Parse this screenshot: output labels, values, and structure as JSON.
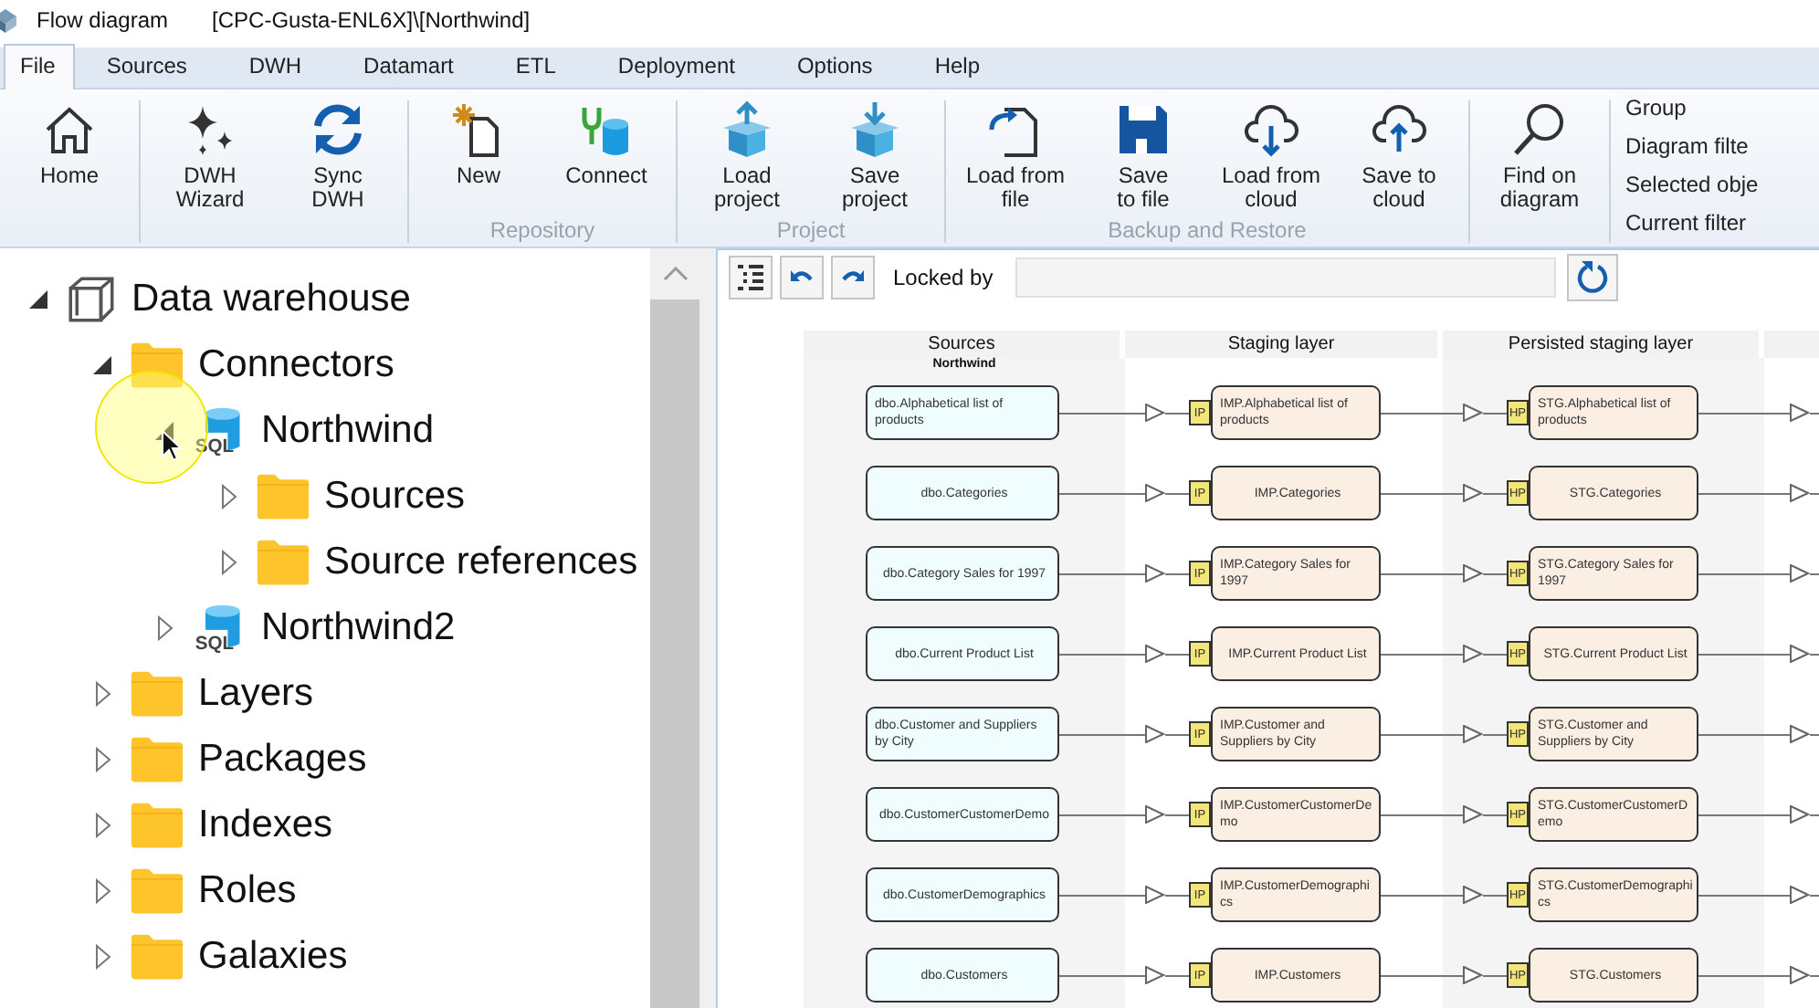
{
  "window": {
    "title": "Flow diagram",
    "path": "[CPC-Gusta-ENL6X]\\[Northwind]"
  },
  "tabs": [
    {
      "label": "File",
      "selected": true
    },
    {
      "label": "Sources",
      "selected": false
    },
    {
      "label": "DWH",
      "selected": false
    },
    {
      "label": "Datamart",
      "selected": false
    },
    {
      "label": "ETL",
      "selected": false
    },
    {
      "label": "Deployment",
      "selected": false
    },
    {
      "label": "Options",
      "selected": false
    },
    {
      "label": "Help",
      "selected": false
    }
  ],
  "ribbon": {
    "groups": [
      {
        "buttons": [
          {
            "label": "Home",
            "kind": "home"
          }
        ]
      },
      {
        "buttons": [
          {
            "label": "DWH\nWizard",
            "kind": "sparkle"
          },
          {
            "label": "Sync\nDWH",
            "kind": "sync"
          }
        ]
      },
      {
        "caption": "Repository",
        "buttons": [
          {
            "label": "New",
            "kind": "new"
          },
          {
            "label": "Connect",
            "kind": "connect"
          }
        ]
      },
      {
        "caption": "Project",
        "buttons": [
          {
            "label": "Load\nproject",
            "kind": "boxup"
          },
          {
            "label": "Save\nproject",
            "kind": "boxdown"
          }
        ]
      },
      {
        "caption": "Backup and Restore",
        "buttons": [
          {
            "label": "Load from\nfile",
            "kind": "fileload"
          },
          {
            "label": "Save\nto file",
            "kind": "floppy"
          },
          {
            "label": "Load from\ncloud",
            "kind": "clouddown"
          },
          {
            "label": "Save to\ncloud",
            "kind": "cloudup"
          }
        ]
      },
      {
        "buttons": [
          {
            "label": "Find on\ndiagram",
            "kind": "find"
          }
        ]
      }
    ],
    "side_items": [
      "Group",
      "Diagram filte",
      "Selected obje",
      "Current filter"
    ]
  },
  "tree": [
    {
      "label": "Data warehouse",
      "kind": "cube",
      "expanded": true,
      "children": [
        {
          "label": "Connectors",
          "kind": "folder",
          "expanded": true,
          "children": [
            {
              "label": "Northwind",
              "kind": "sql",
              "icon_text": "SQL",
              "expanded": true,
              "children": [
                {
                  "label": "Sources",
                  "kind": "folder",
                  "expanded": false
                },
                {
                  "label": "Source references",
                  "kind": "folder",
                  "expanded": false
                }
              ]
            },
            {
              "label": "Northwind2",
              "kind": "sql",
              "icon_text": "SQL",
              "expanded": false
            }
          ]
        },
        {
          "label": "Layers",
          "kind": "folder",
          "expanded": false
        },
        {
          "label": "Packages",
          "kind": "folder",
          "expanded": false
        },
        {
          "label": "Indexes",
          "kind": "folder",
          "expanded": false
        },
        {
          "label": "Roles",
          "kind": "folder",
          "expanded": false
        },
        {
          "label": "Galaxies",
          "kind": "folder",
          "expanded": false
        }
      ]
    }
  ],
  "toolbar": {
    "locked_by_label": "Locked by"
  },
  "diagram": {
    "columns": [
      "Sources",
      "Staging layer",
      "Persisted staging layer"
    ],
    "source_group": "Northwind",
    "rows": [
      {
        "source": "dbo.Alphabetical list of products",
        "staging_badge": "IP",
        "staging": "IMP.Alphabetical list of products",
        "persisted_badge": "HP",
        "persisted": "STG.Alphabetical list of products"
      },
      {
        "source": "dbo.Categories",
        "staging_badge": "IP",
        "staging": "IMP.Categories",
        "persisted_badge": "HP",
        "persisted": "STG.Categories"
      },
      {
        "source": "dbo.Category Sales for 1997",
        "staging_badge": "IP",
        "staging": "IMP.Category Sales for 1997",
        "persisted_badge": "HP",
        "persisted": "STG.Category Sales for 1997"
      },
      {
        "source": "dbo.Current Product List",
        "staging_badge": "IP",
        "staging": "IMP.Current Product List",
        "persisted_badge": "HP",
        "persisted": "STG.Current Product List"
      },
      {
        "source": "dbo.Customer and Suppliers by City",
        "staging_badge": "IP",
        "staging": "IMP.Customer and Suppliers by City",
        "persisted_badge": "HP",
        "persisted": "STG.Customer and Suppliers by City"
      },
      {
        "source": "dbo.CustomerCustomerDemo",
        "staging_badge": "IP",
        "staging": "IMP.CustomerCustomerDemo",
        "persisted_badge": "HP",
        "persisted": "STG.CustomerCustomerDemo"
      },
      {
        "source": "dbo.CustomerDemographics",
        "staging_badge": "IP",
        "staging": "IMP.CustomerDemographics",
        "persisted_badge": "HP",
        "persisted": "STG.CustomerDemographics"
      },
      {
        "source": "dbo.Customers",
        "staging_badge": "IP",
        "staging": "IMP.Customers",
        "persisted_badge": "HP",
        "persisted": "STG.Customers"
      }
    ]
  }
}
